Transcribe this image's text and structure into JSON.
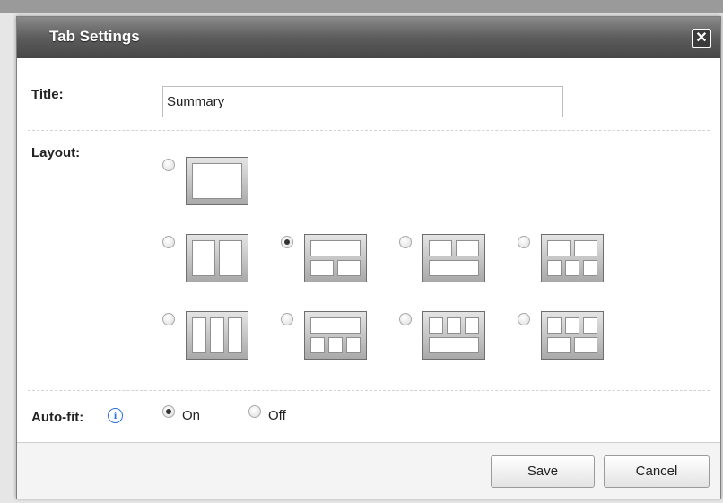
{
  "dialog": {
    "title": "Tab Settings",
    "close_icon": "close-icon"
  },
  "form": {
    "title_label": "Title:",
    "title_value": "Summary",
    "layout_label": "Layout:",
    "layout_selected": 2,
    "layouts": [
      {
        "name": "single"
      },
      {
        "name": "two-columns"
      },
      {
        "name": "one-top-two-bottom"
      },
      {
        "name": "two-top-one-bottom"
      },
      {
        "name": "two-top-three-bottom"
      },
      {
        "name": "three-columns"
      },
      {
        "name": "one-top-three-bottom"
      },
      {
        "name": "three-top-one-bottom"
      },
      {
        "name": "three-top-two-bottom"
      }
    ],
    "autofit_label": "Auto-fit:",
    "autofit_info_icon": "info-icon",
    "autofit_on": "On",
    "autofit_off": "Off",
    "autofit_selected": "On"
  },
  "footer": {
    "save_label": "Save",
    "cancel_label": "Cancel"
  }
}
